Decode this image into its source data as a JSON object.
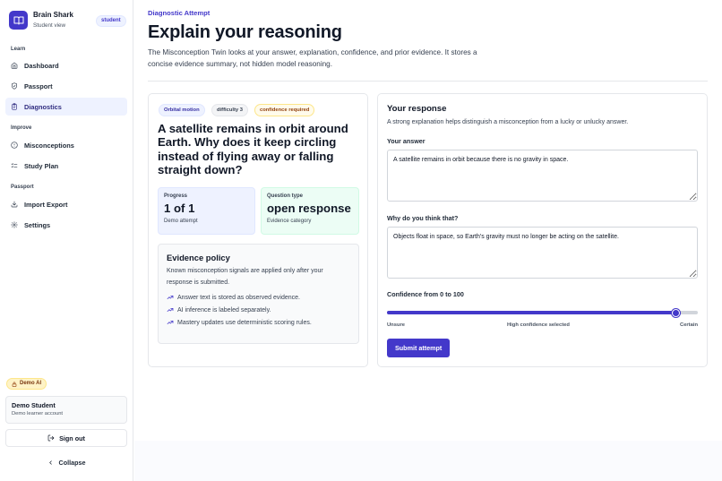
{
  "brand": {
    "name": "Brain Shark",
    "subtitle": "Student view",
    "role": "student"
  },
  "sidebar": {
    "sections": [
      {
        "label": "Learn",
        "items": [
          {
            "label": "Dashboard",
            "icon": "home-icon"
          },
          {
            "label": "Passport",
            "icon": "shield-icon"
          },
          {
            "label": "Diagnostics",
            "icon": "clipboard-icon",
            "active": true
          }
        ]
      },
      {
        "label": "Improve",
        "items": [
          {
            "label": "Misconceptions",
            "icon": "alert-circle-icon"
          },
          {
            "label": "Study Plan",
            "icon": "list-icon"
          }
        ]
      },
      {
        "label": "Passport",
        "items": [
          {
            "label": "Import Export",
            "icon": "download-icon"
          },
          {
            "label": "Settings",
            "icon": "gear-icon"
          }
        ]
      }
    ],
    "demo_badge": "Demo AI",
    "account": {
      "name": "Demo Student",
      "subtitle": "Demo learner account"
    },
    "signout_label": "Sign out",
    "collapse_label": "Collapse"
  },
  "header": {
    "eyebrow": "Diagnostic Attempt",
    "title": "Explain your reasoning",
    "description": "The Misconception Twin looks at your answer, explanation, confidence, and prior evidence. It stores a concise evidence summary, not hidden model reasoning."
  },
  "question_card": {
    "chips": {
      "topic": "Orbital motion",
      "difficulty": "difficulty 3",
      "confidence": "confidence required"
    },
    "question": "A satellite remains in orbit around Earth. Why does it keep circling instead of flying away or falling straight down?",
    "progress": {
      "label": "Progress",
      "value": "1 of 1",
      "sub": "Demo attempt"
    },
    "question_type": {
      "label": "Question type",
      "value": "open response",
      "sub": "Evidence category"
    },
    "policy": {
      "title": "Evidence policy",
      "description": "Known misconception signals are applied only after your response is submitted.",
      "items": [
        "Answer text is stored as observed evidence.",
        "AI inference is labeled separately.",
        "Mastery updates use deterministic scoring rules."
      ]
    }
  },
  "response_card": {
    "title": "Your response",
    "description": "A strong explanation helps distinguish a misconception from a lucky or unlucky answer.",
    "answer_label": "Your answer",
    "answer_value": "A satellite remains in orbit because there is no gravity in space.",
    "why_label": "Why do you think that?",
    "why_value": "Objects float in space, so Earth's gravity must no longer be acting on the satellite.",
    "confidence_label": "Confidence from 0 to 100",
    "confidence_value": 93,
    "slider_min_label": "Unsure",
    "slider_mid_label": "High confidence selected",
    "slider_max_label": "Certain",
    "submit_label": "Submit attempt"
  },
  "colors": {
    "accent": "#4338ca",
    "accent_soft": "#eef2ff",
    "success_soft": "#ecfdf5",
    "warning_soft": "#fffbeb"
  }
}
